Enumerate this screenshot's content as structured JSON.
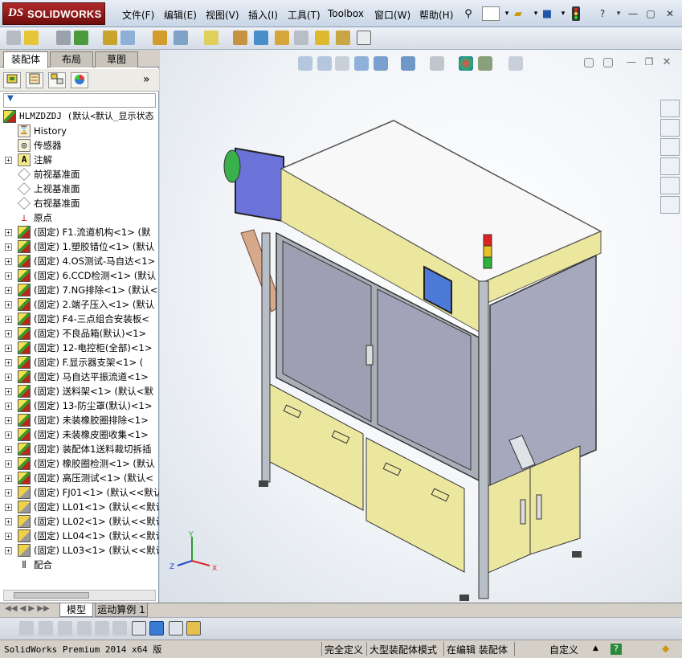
{
  "app": {
    "logo_ds": "DS",
    "logo_name": "SOLIDWORKS"
  },
  "menu": [
    {
      "label": "文件(F)"
    },
    {
      "label": "编辑(E)"
    },
    {
      "label": "视图(V)"
    },
    {
      "label": "插入(I)"
    },
    {
      "label": "工具(T)"
    },
    {
      "label": "Toolbox"
    },
    {
      "label": "窗口(W)"
    },
    {
      "label": "帮助(H)"
    }
  ],
  "window_controls": {
    "help": "?",
    "minimize": "—",
    "restore": "▢",
    "close": "✕"
  },
  "panel_tabs": [
    {
      "label": "装配体"
    },
    {
      "label": "布局"
    },
    {
      "label": "草图"
    }
  ],
  "panel_more": "»",
  "filter_icon": "▼",
  "tree": {
    "root": "HLMZDZDJ  (默认<默认_显示状态",
    "items": [
      {
        "label": "History",
        "icon": "history-icon",
        "expander": ""
      },
      {
        "label": "传感器",
        "icon": "sensor-icon",
        "expander": ""
      },
      {
        "label": "注解",
        "icon": "annotation-icon",
        "expander": "+"
      },
      {
        "label": "前视基准面",
        "icon": "plane-icon",
        "expander": ""
      },
      {
        "label": "上视基准面",
        "icon": "plane-icon",
        "expander": ""
      },
      {
        "label": "右视基准面",
        "icon": "plane-icon",
        "expander": ""
      },
      {
        "label": "原点",
        "icon": "origin-icon",
        "expander": ""
      },
      {
        "label": "(固定) F1.流道机构<1> (默",
        "icon": "part-icon",
        "expander": "+"
      },
      {
        "label": "(固定) 1.塑胶错位<1> (默认",
        "icon": "part-icon",
        "expander": "+"
      },
      {
        "label": "(固定) 4.OS测试-马自达<1>",
        "icon": "part-icon",
        "expander": "+"
      },
      {
        "label": "(固定) 6.CCD检测<1> (默认",
        "icon": "part-icon",
        "expander": "+"
      },
      {
        "label": "(固定) 7.NG排除<1> (默认<",
        "icon": "part-icon",
        "expander": "+"
      },
      {
        "label": "(固定) 2.端子压入<1> (默认",
        "icon": "part-icon",
        "expander": "+"
      },
      {
        "label": "(固定) F4-三点组合安装板<",
        "icon": "part-icon",
        "expander": "+"
      },
      {
        "label": "(固定) 不良品箱(默认)<1>",
        "icon": "part-icon",
        "expander": "+"
      },
      {
        "label": "(固定) 12-电控柜(全部)<1>",
        "icon": "part-icon",
        "expander": "+"
      },
      {
        "label": "(固定) F.显示器支架<1> (",
        "icon": "part-icon",
        "expander": "+"
      },
      {
        "label": "(固定) 马自达平振流道<1>",
        "icon": "part-icon",
        "expander": "+"
      },
      {
        "label": "(固定) 送料架<1> (默认<默",
        "icon": "part-icon",
        "expander": "+"
      },
      {
        "label": "(固定) 13-防尘罩(默认)<1>",
        "icon": "part-icon",
        "expander": "+"
      },
      {
        "label": "(固定) 未装橡胶圈排除<1>",
        "icon": "part-icon",
        "expander": "+"
      },
      {
        "label": "(固定) 未装橡皮圈收集<1>",
        "icon": "part-icon",
        "expander": "+"
      },
      {
        "label": "(固定) 装配体1送料裁切拆插",
        "icon": "part-icon",
        "expander": "+"
      },
      {
        "label": "(固定) 橡胶圈检测<1> (默认",
        "icon": "part-icon",
        "expander": "+"
      },
      {
        "label": "(固定) 高压测试<1> (默认<",
        "icon": "part-icon",
        "expander": "+"
      },
      {
        "label": "(固定) FJ01<1> (默认<<默认",
        "icon": "subpart-icon",
        "expander": "+"
      },
      {
        "label": "(固定) LL01<1> (默认<<默认",
        "icon": "subpart-icon",
        "expander": "+"
      },
      {
        "label": "(固定) LL02<1> (默认<<默认",
        "icon": "subpart-icon",
        "expander": "+"
      },
      {
        "label": "(固定) LL04<1> (默认<<默认",
        "icon": "subpart-icon",
        "expander": "+"
      },
      {
        "label": "(固定) LL03<1> (默认<<默认",
        "icon": "subpart-icon",
        "expander": "+"
      },
      {
        "label": "配合",
        "icon": "mates-icon",
        "expander": ""
      }
    ]
  },
  "bottom_tabs": [
    {
      "label": "模型"
    },
    {
      "label": "运动算例 1"
    }
  ],
  "status": {
    "product": "SolidWorks Premium 2014 x64 版",
    "definition": "完全定义",
    "mode": "大型装配体模式",
    "editing": "在编辑 装配体",
    "units": "自定义",
    "units_arrow": "▲",
    "help_btn": "?"
  },
  "triad": {
    "x": "X",
    "y": "Y",
    "z": "Z"
  },
  "colors": {
    "panel_bg": "#d4d0c8",
    "machine_yellow": "#ece79f",
    "machine_frame": "#a9afb7",
    "window_glass": "#9e9fb3",
    "accent_blue": "#1f5cb5"
  }
}
